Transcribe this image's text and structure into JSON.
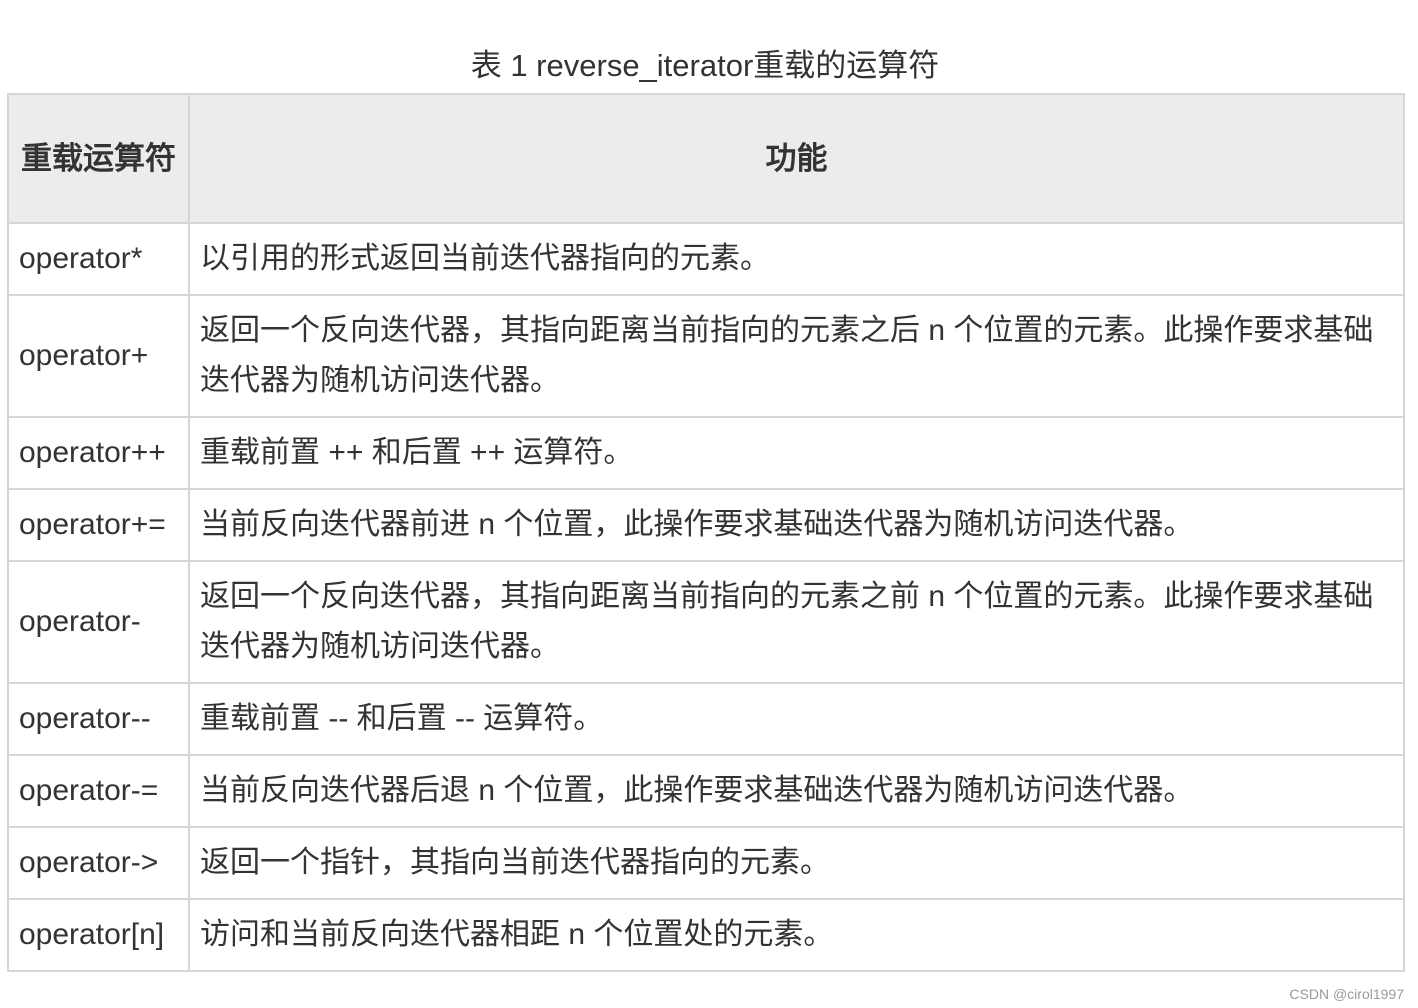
{
  "caption": "表 1 reverse_iterator重载的运算符",
  "table": {
    "headers": {
      "operator": "重载运算符",
      "function": "功能"
    },
    "rows": [
      {
        "operator": "operator*",
        "function": "以引用的形式返回当前迭代器指向的元素。"
      },
      {
        "operator": "operator+",
        "function": "返回一个反向迭代器，其指向距离当前指向的元素之后 n 个位置的元素。此操作要求基础迭代器为随机访问迭代器。"
      },
      {
        "operator": "operator++",
        "function": "重载前置 ++ 和后置 ++ 运算符。"
      },
      {
        "operator": "operator+=",
        "function": "当前反向迭代器前进 n 个位置，此操作要求基础迭代器为随机访问迭代器。"
      },
      {
        "operator": "operator-",
        "function": "返回一个反向迭代器，其指向距离当前指向的元素之前 n 个位置的元素。此操作要求基础迭代器为随机访问迭代器。"
      },
      {
        "operator": "operator--",
        "function": "重载前置 -- 和后置 -- 运算符。"
      },
      {
        "operator": "operator-=",
        "function": "当前反向迭代器后退 n 个位置，此操作要求基础迭代器为随机访问迭代器。"
      },
      {
        "operator": "operator->",
        "function": "返回一个指针，其指向当前迭代器指向的元素。"
      },
      {
        "operator": "operator[n]",
        "function": "访问和当前反向迭代器相距 n 个位置处的元素。"
      }
    ]
  },
  "watermark": "CSDN @cirol1997"
}
